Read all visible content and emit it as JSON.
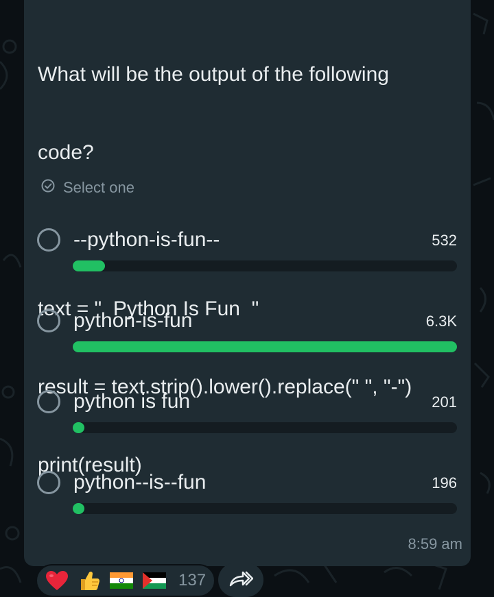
{
  "question": {
    "lines": [
      "What will be the output of the following",
      "code?",
      "",
      "text = \"  Python Is Fun  \"",
      "result = text.strip().lower().replace(\" \", \"-\")",
      "print(result)"
    ]
  },
  "poll": {
    "instruction": "Select one",
    "options": [
      {
        "label": "--python-is-fun--",
        "count": "532",
        "fraction": 0.084
      },
      {
        "label": "python-is-fun",
        "count": "6.3K",
        "fraction": 1.0
      },
      {
        "label": "python is fun",
        "count": "201",
        "fraction": 0.03
      },
      {
        "label": "python--is--fun",
        "count": "196",
        "fraction": 0.03
      }
    ]
  },
  "timestamp": "8:59 am",
  "reactions": {
    "emojis": [
      "red-heart",
      "thumbs-up",
      "india-flag",
      "palestine-flag"
    ],
    "count": "137"
  },
  "colors": {
    "accent_green": "#21c063",
    "bubble": "#1f2c33",
    "background": "#0b1014"
  }
}
